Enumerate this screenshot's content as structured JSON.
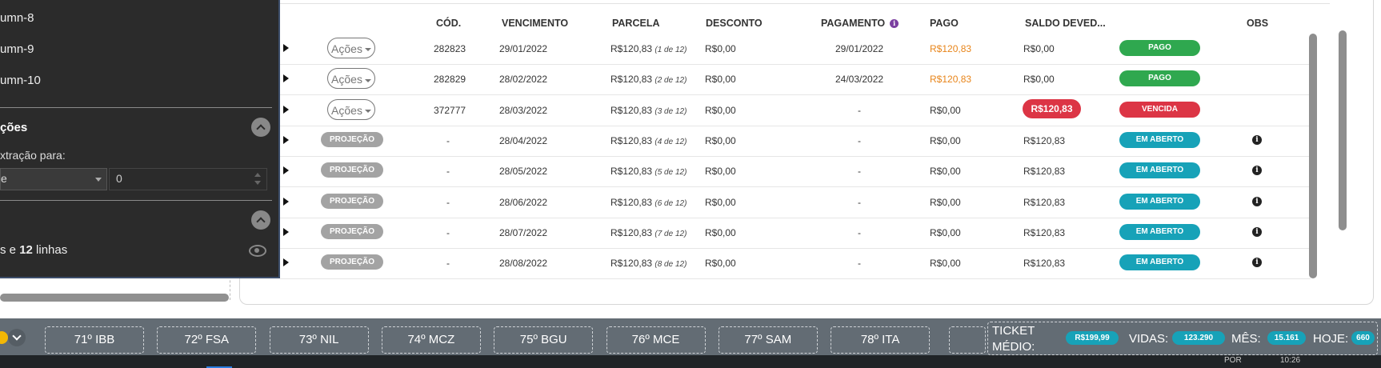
{
  "table": {
    "headers": {
      "cod": "CÓD.",
      "vencimento": "VENCIMENTO",
      "parcela": "PARCELA",
      "desconto": "DESCONTO",
      "pagamento": "PAGAMENTO",
      "pago": "PAGO",
      "saldo": "SALDO DEVED...",
      "obs": "OBS"
    },
    "rows": [
      {
        "action": "Ações",
        "cod": "282823",
        "venc": "29/01/2022",
        "parcela": "R$120,83",
        "parcela_of": "(1 de 12)",
        "desconto": "R$0,00",
        "pagamento": "29/01/2022",
        "pago": "R$120,83",
        "saldo": "R$0,00",
        "status": "PAGO"
      },
      {
        "action": "Ações",
        "cod": "282829",
        "venc": "28/02/2022",
        "parcela": "R$120,83",
        "parcela_of": "(2 de 12)",
        "desconto": "R$0,00",
        "pagamento": "24/03/2022",
        "pago": "R$120,83",
        "saldo": "R$0,00",
        "status": "PAGO"
      },
      {
        "action": "Ações",
        "cod": "372777",
        "venc": "28/03/2022",
        "parcela": "R$120,83",
        "parcela_of": "(3 de 12)",
        "desconto": "R$0,00",
        "pagamento": "-",
        "pago": "R$0,00",
        "saldo": "R$120,83",
        "status": "VENCIDA"
      },
      {
        "action": "PROJEÇÃO",
        "cod": "-",
        "venc": "28/04/2022",
        "parcela": "R$120,83",
        "parcela_of": "(4 de 12)",
        "desconto": "R$0,00",
        "pagamento": "-",
        "pago": "R$0,00",
        "saldo": "R$120,83",
        "status": "EM ABERTO"
      },
      {
        "action": "PROJEÇÃO",
        "cod": "-",
        "venc": "28/05/2022",
        "parcela": "R$120,83",
        "parcela_of": "(5 de 12)",
        "desconto": "R$0,00",
        "pagamento": "-",
        "pago": "R$0,00",
        "saldo": "R$120,83",
        "status": "EM ABERTO"
      },
      {
        "action": "PROJEÇÃO",
        "cod": "-",
        "venc": "28/06/2022",
        "parcela": "R$120,83",
        "parcela_of": "(6 de 12)",
        "desconto": "R$0,00",
        "pagamento": "-",
        "pago": "R$0,00",
        "saldo": "R$120,83",
        "status": "EM ABERTO"
      },
      {
        "action": "PROJEÇÃO",
        "cod": "-",
        "venc": "28/07/2022",
        "parcela": "R$120,83",
        "parcela_of": "(7 de 12)",
        "desconto": "R$0,00",
        "pagamento": "-",
        "pago": "R$0,00",
        "saldo": "R$120,83",
        "status": "EM ABERTO"
      },
      {
        "action": "PROJEÇÃO",
        "cod": "-",
        "venc": "28/08/2022",
        "parcela": "R$120,83",
        "parcela_of": "(8 de 12)",
        "desconto": "R$0,00",
        "pagamento": "-",
        "pago": "R$0,00",
        "saldo": "R$120,83",
        "status": "EM ABERTO"
      }
    ]
  },
  "panel": {
    "items": [
      "umn-8",
      "umn-9",
      "umn-10"
    ],
    "section1": "ções",
    "extract_label": "xtração para:",
    "select_value": "e",
    "number_value": "0",
    "footer_prefix": "s e ",
    "footer_count": "12",
    "footer_suffix": " linhas"
  },
  "bottom_bar": {
    "ranks": [
      "71º IBB",
      "72º FSA",
      "73º NIL",
      "74º MCZ",
      "75º BGU",
      "76º MCE",
      "77º SAM",
      "78º ITA"
    ],
    "ticket_label": "TICKET MÉDIO:",
    "ticket_value": "R$199,99",
    "vidas_label": "VIDAS:",
    "vidas_value": "123.290",
    "mes_label": "MÊS:",
    "mes_value": "15.161",
    "hoje_label": "HOJE:",
    "hoje_value": "660"
  },
  "status_strip": {
    "left": "POR",
    "right": "10:26"
  },
  "colors": {
    "status_pago": "#2fa84f",
    "status_vencida": "#dc3545",
    "status_em_aberto": "#17a2b8",
    "pago_orange": "#e8851a",
    "projecao_gray": "#a3a3a3"
  }
}
